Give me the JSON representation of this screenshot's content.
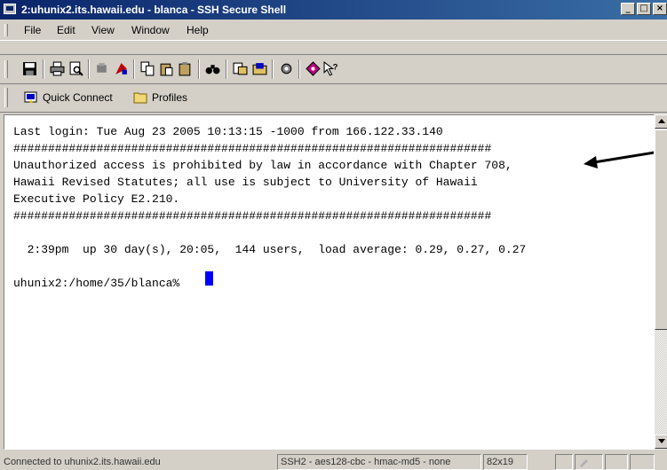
{
  "window": {
    "title": "2:uhunix2.its.hawaii.edu - blanca - SSH Secure Shell",
    "min_label": "_",
    "max_label": "□",
    "close_label": "×"
  },
  "menu": {
    "items": [
      {
        "label": "File"
      },
      {
        "label": "Edit"
      },
      {
        "label": "View"
      },
      {
        "label": "Window"
      },
      {
        "label": "Help"
      }
    ]
  },
  "toolbar": {
    "icons": [
      "save-icon",
      "print-icon",
      "print-preview-icon",
      "disconnect-icon",
      "settings-icon",
      "copy-icon",
      "paste-icon",
      "paste-alt-icon",
      "find-icon",
      "file-transfer-icon",
      "folder-transfer-icon",
      "key-manager-icon",
      "profile-icon",
      "help-pointer-icon"
    ]
  },
  "quickbar": {
    "quick_connect": "Quick Connect",
    "profiles": "Profiles"
  },
  "terminal": {
    "lines": [
      "Last login: Tue Aug 23 2005 10:13:15 -1000 from 166.122.33.140",
      "#####################################################################",
      "Unauthorized access is prohibited by law in accordance with Chapter 708,",
      "Hawaii Revised Statutes; all use is subject to University of Hawaii",
      "Executive Policy E2.210.",
      "#####################################################################",
      "",
      "  2:39pm  up 30 day(s), 20:05,  144 users,  load average: 0.29, 0.27, 0.27",
      "",
      "uhunix2:/home/35/blanca% "
    ]
  },
  "statusbar": {
    "connection": "Connected to uhunix2.its.hawaii.edu",
    "cipher": "SSH2 - aes128-cbc - hmac-md5 - none",
    "size": "82x19"
  },
  "colors": {
    "titlebar_start": "#0a246a",
    "titlebar_end": "#3a6ea5",
    "cursor": "#0000ff",
    "chrome": "#d4d0c8"
  }
}
